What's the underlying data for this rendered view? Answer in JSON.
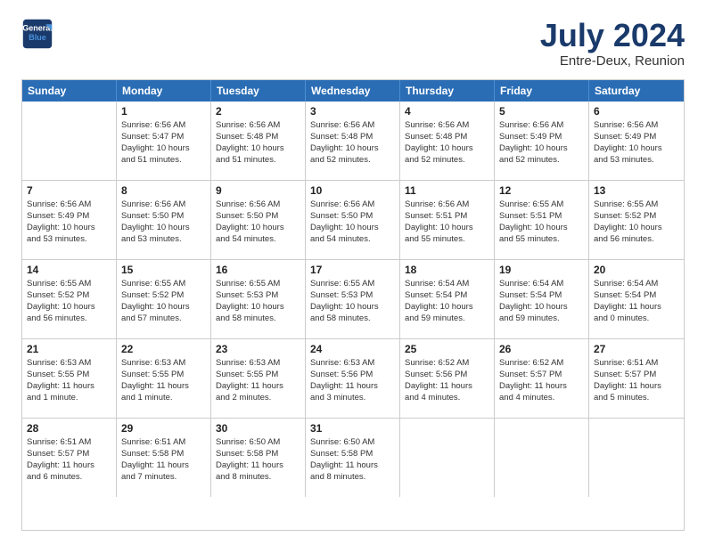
{
  "logo": {
    "line1": "General",
    "line2": "Blue"
  },
  "title": "July 2024",
  "subtitle": "Entre-Deux, Reunion",
  "header_days": [
    "Sunday",
    "Monday",
    "Tuesday",
    "Wednesday",
    "Thursday",
    "Friday",
    "Saturday"
  ],
  "weeks": [
    [
      {
        "day": "",
        "info": ""
      },
      {
        "day": "1",
        "info": "Sunrise: 6:56 AM\nSunset: 5:47 PM\nDaylight: 10 hours\nand 51 minutes."
      },
      {
        "day": "2",
        "info": "Sunrise: 6:56 AM\nSunset: 5:48 PM\nDaylight: 10 hours\nand 51 minutes."
      },
      {
        "day": "3",
        "info": "Sunrise: 6:56 AM\nSunset: 5:48 PM\nDaylight: 10 hours\nand 52 minutes."
      },
      {
        "day": "4",
        "info": "Sunrise: 6:56 AM\nSunset: 5:48 PM\nDaylight: 10 hours\nand 52 minutes."
      },
      {
        "day": "5",
        "info": "Sunrise: 6:56 AM\nSunset: 5:49 PM\nDaylight: 10 hours\nand 52 minutes."
      },
      {
        "day": "6",
        "info": "Sunrise: 6:56 AM\nSunset: 5:49 PM\nDaylight: 10 hours\nand 53 minutes."
      }
    ],
    [
      {
        "day": "7",
        "info": "Sunrise: 6:56 AM\nSunset: 5:49 PM\nDaylight: 10 hours\nand 53 minutes."
      },
      {
        "day": "8",
        "info": "Sunrise: 6:56 AM\nSunset: 5:50 PM\nDaylight: 10 hours\nand 53 minutes."
      },
      {
        "day": "9",
        "info": "Sunrise: 6:56 AM\nSunset: 5:50 PM\nDaylight: 10 hours\nand 54 minutes."
      },
      {
        "day": "10",
        "info": "Sunrise: 6:56 AM\nSunset: 5:50 PM\nDaylight: 10 hours\nand 54 minutes."
      },
      {
        "day": "11",
        "info": "Sunrise: 6:56 AM\nSunset: 5:51 PM\nDaylight: 10 hours\nand 55 minutes."
      },
      {
        "day": "12",
        "info": "Sunrise: 6:55 AM\nSunset: 5:51 PM\nDaylight: 10 hours\nand 55 minutes."
      },
      {
        "day": "13",
        "info": "Sunrise: 6:55 AM\nSunset: 5:52 PM\nDaylight: 10 hours\nand 56 minutes."
      }
    ],
    [
      {
        "day": "14",
        "info": "Sunrise: 6:55 AM\nSunset: 5:52 PM\nDaylight: 10 hours\nand 56 minutes."
      },
      {
        "day": "15",
        "info": "Sunrise: 6:55 AM\nSunset: 5:52 PM\nDaylight: 10 hours\nand 57 minutes."
      },
      {
        "day": "16",
        "info": "Sunrise: 6:55 AM\nSunset: 5:53 PM\nDaylight: 10 hours\nand 58 minutes."
      },
      {
        "day": "17",
        "info": "Sunrise: 6:55 AM\nSunset: 5:53 PM\nDaylight: 10 hours\nand 58 minutes."
      },
      {
        "day": "18",
        "info": "Sunrise: 6:54 AM\nSunset: 5:54 PM\nDaylight: 10 hours\nand 59 minutes."
      },
      {
        "day": "19",
        "info": "Sunrise: 6:54 AM\nSunset: 5:54 PM\nDaylight: 10 hours\nand 59 minutes."
      },
      {
        "day": "20",
        "info": "Sunrise: 6:54 AM\nSunset: 5:54 PM\nDaylight: 11 hours\nand 0 minutes."
      }
    ],
    [
      {
        "day": "21",
        "info": "Sunrise: 6:53 AM\nSunset: 5:55 PM\nDaylight: 11 hours\nand 1 minute."
      },
      {
        "day": "22",
        "info": "Sunrise: 6:53 AM\nSunset: 5:55 PM\nDaylight: 11 hours\nand 1 minute."
      },
      {
        "day": "23",
        "info": "Sunrise: 6:53 AM\nSunset: 5:55 PM\nDaylight: 11 hours\nand 2 minutes."
      },
      {
        "day": "24",
        "info": "Sunrise: 6:53 AM\nSunset: 5:56 PM\nDaylight: 11 hours\nand 3 minutes."
      },
      {
        "day": "25",
        "info": "Sunrise: 6:52 AM\nSunset: 5:56 PM\nDaylight: 11 hours\nand 4 minutes."
      },
      {
        "day": "26",
        "info": "Sunrise: 6:52 AM\nSunset: 5:57 PM\nDaylight: 11 hours\nand 4 minutes."
      },
      {
        "day": "27",
        "info": "Sunrise: 6:51 AM\nSunset: 5:57 PM\nDaylight: 11 hours\nand 5 minutes."
      }
    ],
    [
      {
        "day": "28",
        "info": "Sunrise: 6:51 AM\nSunset: 5:57 PM\nDaylight: 11 hours\nand 6 minutes."
      },
      {
        "day": "29",
        "info": "Sunrise: 6:51 AM\nSunset: 5:58 PM\nDaylight: 11 hours\nand 7 minutes."
      },
      {
        "day": "30",
        "info": "Sunrise: 6:50 AM\nSunset: 5:58 PM\nDaylight: 11 hours\nand 8 minutes."
      },
      {
        "day": "31",
        "info": "Sunrise: 6:50 AM\nSunset: 5:58 PM\nDaylight: 11 hours\nand 8 minutes."
      },
      {
        "day": "",
        "info": ""
      },
      {
        "day": "",
        "info": ""
      },
      {
        "day": "",
        "info": ""
      }
    ]
  ]
}
